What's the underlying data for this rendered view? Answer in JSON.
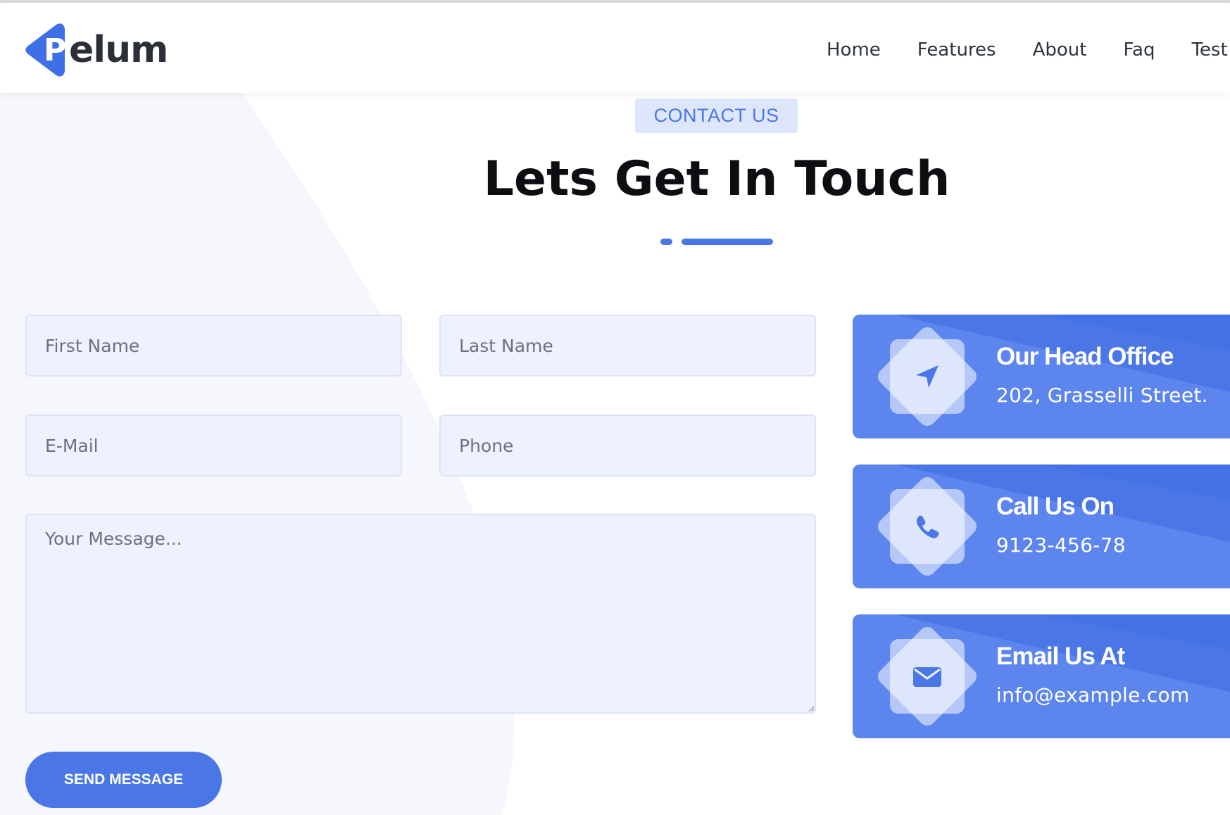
{
  "brand": {
    "logo_letter": "P",
    "logo_text": "elum",
    "accent": "#4a77e5"
  },
  "nav": {
    "items": [
      "Home",
      "Features",
      "About",
      "Faq",
      "Test"
    ]
  },
  "section": {
    "badge": "CONTACT US",
    "title": "Lets Get In Touch"
  },
  "form": {
    "first_name_placeholder": "First Name",
    "last_name_placeholder": "Last Name",
    "email_placeholder": "E-Mail",
    "phone_placeholder": "Phone",
    "message_placeholder": "Your Message...",
    "send_label": "SEND MESSAGE"
  },
  "cards": [
    {
      "icon": "location-arrow-icon",
      "title": "Our Head Office",
      "text": "202, Grasselli Street."
    },
    {
      "icon": "phone-icon",
      "title": "Call Us On",
      "text": "9123-456-78"
    },
    {
      "icon": "envelope-icon",
      "title": "Email Us At",
      "text": "info@example.com"
    }
  ],
  "colors": {
    "card_bg": "#5c85ee",
    "field_bg": "#eef2fe",
    "badge_bg": "#dde6fb"
  }
}
